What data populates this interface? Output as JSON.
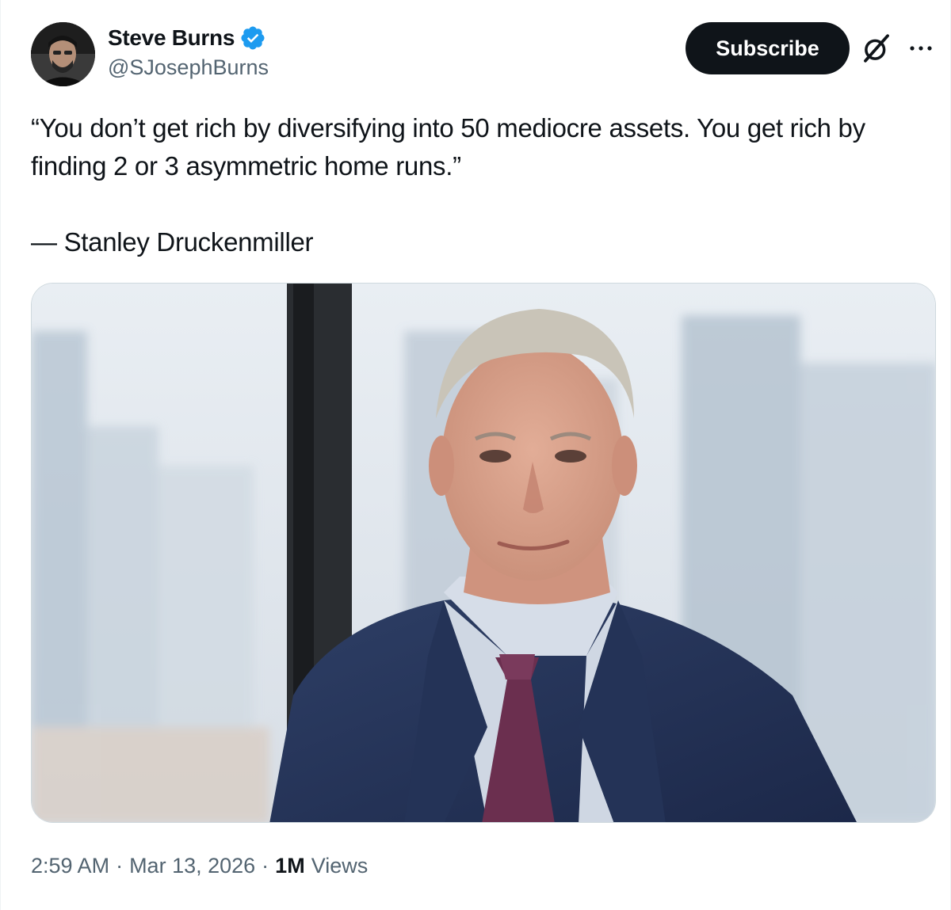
{
  "author": {
    "display_name": "Steve Burns",
    "handle": "@SJosephBurns",
    "verified_icon": "verified-badge-icon",
    "avatar_icon": "avatar-photo"
  },
  "header": {
    "subscribe_label": "Subscribe",
    "grok_icon": "grok-icon",
    "more_icon": "more-options-icon"
  },
  "tweet": {
    "quote": "“You don’t get rich by diversifying into 50 mediocre assets. You get rich by finding 2 or 3 asymmetric home runs.”",
    "attribution": "— Stanley Druckenmiller"
  },
  "meta": {
    "time": "2:59 AM",
    "separator": "·",
    "date": "Mar 13, 2026",
    "views_count": "1M",
    "views_label": "Views"
  },
  "colors": {
    "text_primary": "#0f1419",
    "text_secondary": "#536471",
    "verified_blue": "#1d9bf0",
    "button_bg": "#0f1419",
    "border": "#cfd9de"
  }
}
